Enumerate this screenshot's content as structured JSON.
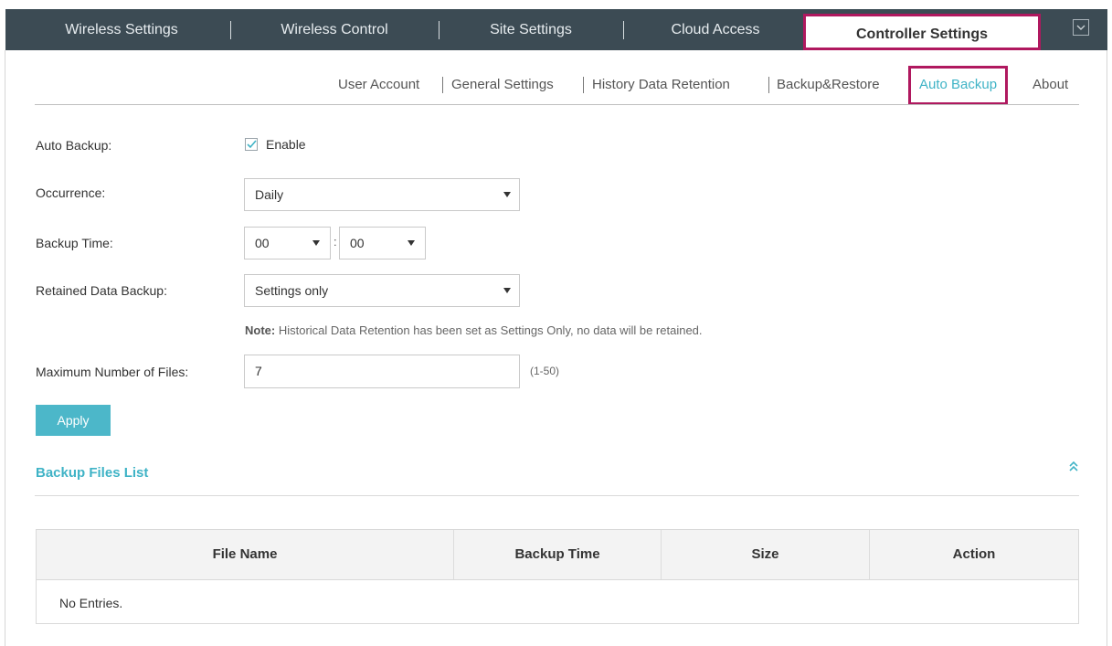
{
  "top_nav": {
    "tabs": [
      {
        "label": "Wireless Settings"
      },
      {
        "label": "Wireless Control"
      },
      {
        "label": "Site Settings"
      },
      {
        "label": "Cloud Access"
      },
      {
        "label": "Controller Settings",
        "active": true
      }
    ],
    "menu_icon": "chevron-down-icon"
  },
  "sub_nav": {
    "items": [
      {
        "label": "User Account"
      },
      {
        "label": "General Settings"
      },
      {
        "label": "History Data Retention"
      },
      {
        "label": "Backup&Restore"
      },
      {
        "label": "Auto Backup",
        "active": true
      },
      {
        "label": "About"
      }
    ]
  },
  "form": {
    "auto_backup": {
      "label": "Auto Backup:",
      "checkbox_label": "Enable",
      "checked": true
    },
    "occurrence": {
      "label": "Occurrence:",
      "value": "Daily"
    },
    "backup_time": {
      "label": "Backup Time:",
      "hour": "00",
      "minute": "00",
      "separator": ":"
    },
    "retained_data_backup": {
      "label": "Retained Data Backup:",
      "value": "Settings only"
    },
    "note": {
      "prefix": "Note:",
      "text": " Historical Data Retention has been set as Settings Only, no data will be retained."
    },
    "max_files": {
      "label": "Maximum Number of Files:",
      "value": "7",
      "range": "(1-50)"
    },
    "apply_label": "Apply"
  },
  "backup_files": {
    "title": "Backup Files List",
    "collapse_icon": "double-chevron-up-icon",
    "columns": [
      "File Name",
      "Backup Time",
      "Size",
      "Action"
    ],
    "empty_text": "No Entries."
  },
  "colors": {
    "nav_bg": "#3c4b54",
    "accent": "#3fb3c6",
    "highlight_border": "#b0185f",
    "button": "#4cb7c9"
  }
}
